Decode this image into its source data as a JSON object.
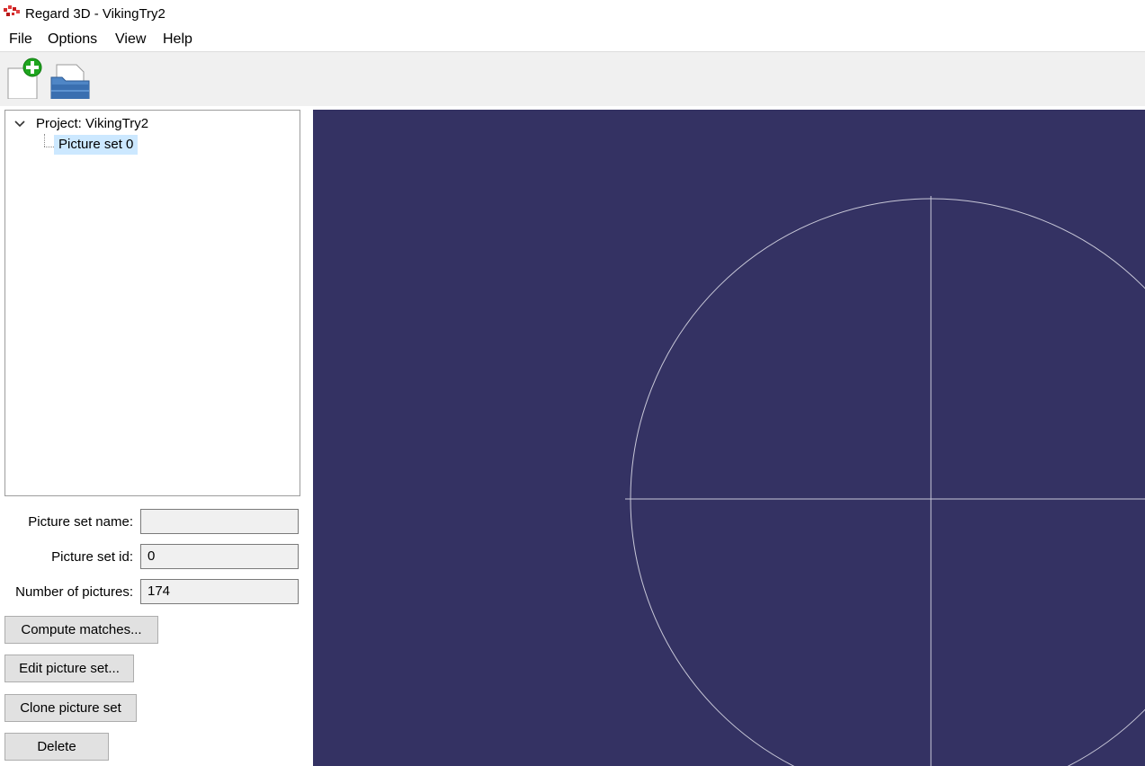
{
  "window": {
    "title": "Regard 3D - VikingTry2",
    "app_icon": "regard3d-app-icon"
  },
  "menu": {
    "items": [
      {
        "label": "File"
      },
      {
        "label": "Options"
      },
      {
        "label": "View"
      },
      {
        "label": "Help"
      }
    ]
  },
  "toolbar": {
    "buttons": [
      {
        "icon": "new-project-icon"
      },
      {
        "icon": "open-project-icon"
      }
    ]
  },
  "tree": {
    "root_label": "Project: VikingTry2",
    "children": [
      {
        "label": "Picture set 0",
        "selected": true
      }
    ]
  },
  "form": {
    "picture_set_name_label": "Picture set name:",
    "picture_set_name_value": "",
    "picture_set_id_label": "Picture set id:",
    "picture_set_id_value": "0",
    "number_of_pictures_label": "Number of pictures:",
    "number_of_pictures_value": "174"
  },
  "buttons": {
    "compute_matches": "Compute matches...",
    "edit_picture_set": "Edit picture set...",
    "clone_picture_set": "Clone picture set",
    "delete": "Delete"
  },
  "viewport": {
    "background_color": "#343263",
    "overlay_color": "#c8c8d8"
  },
  "colors": {
    "selection": "#cce8ff",
    "toolbar_bg": "#f0f0f0"
  }
}
